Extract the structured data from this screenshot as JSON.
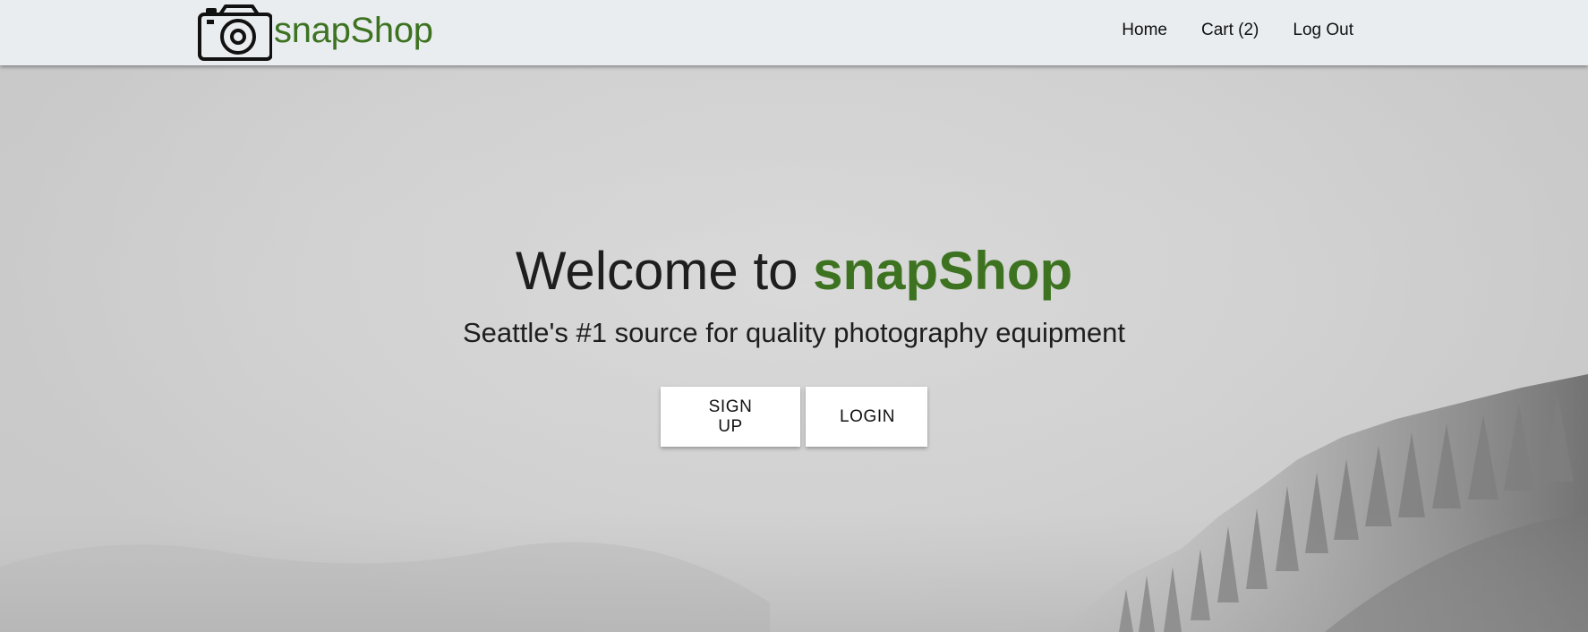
{
  "navbar": {
    "brand_name": "snapShop",
    "brand_color": "#3d7320",
    "logo_icon": "camera-icon",
    "links": [
      {
        "label": "Home"
      },
      {
        "label": "Cart (2)"
      },
      {
        "label": "Log Out"
      }
    ]
  },
  "hero": {
    "title_prefix": "Welcome to ",
    "title_accent": "snapShop",
    "subtitle": "Seattle's #1 source for quality photography equipment",
    "buttons": {
      "signup_label": "SIGN UP",
      "login_label": "LOGIN"
    },
    "background": "foggy-forest-photo"
  }
}
